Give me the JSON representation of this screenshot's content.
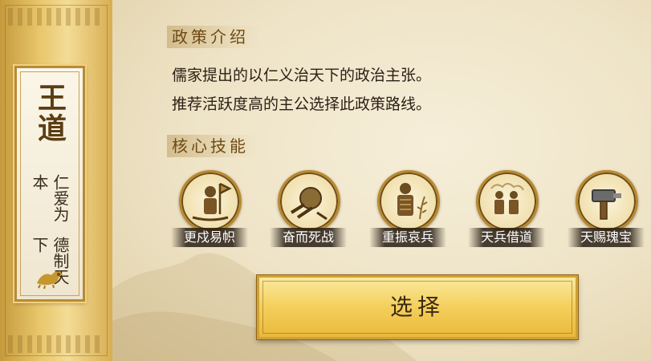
{
  "policy": {
    "name": "王道",
    "motto_col1": "仁爱为本",
    "motto_col2": "德制天下"
  },
  "intro": {
    "title": "政策介绍",
    "lines": [
      "儒家提出的以仁义治天下的政治主张。",
      "推荐活跃度高的主公选择此政策路线。"
    ]
  },
  "skills_section": {
    "title": "核心技能",
    "items": [
      {
        "label": "更戍易帜",
        "icon": "soldier-flag-icon"
      },
      {
        "label": "奋而死战",
        "icon": "fighting-shield-icon"
      },
      {
        "label": "重振哀兵",
        "icon": "armored-soldier-wheat-icon"
      },
      {
        "label": "天兵借道",
        "icon": "soldiers-clouds-icon"
      },
      {
        "label": "天赐瑰宝",
        "icon": "hammer-icon"
      }
    ]
  },
  "action": {
    "select_label": "选择"
  },
  "colors": {
    "gold": "#e8c66b",
    "parchment": "#f3ead2",
    "title_brown": "#6e4a14",
    "button_gold": "#f4cf5b"
  }
}
